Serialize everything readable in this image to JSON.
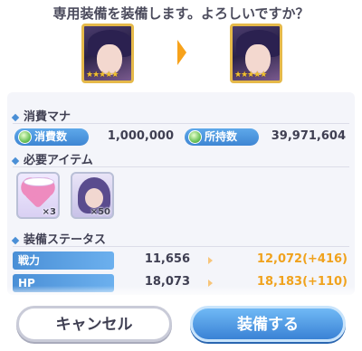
{
  "dialog": {
    "title": "専用装備を装備します。よろしいですか？",
    "portrait_before_stars": "★★★★★",
    "portrait_after_stars": "★★★★★"
  },
  "mana": {
    "heading": "消費マナ",
    "cost_label": "消費数",
    "cost_value": "1,000,000",
    "owned_label": "所持数",
    "owned_value": "39,971,604"
  },
  "items": {
    "heading": "必要アイテム",
    "list": [
      {
        "icon": "heart-item-icon",
        "qty": "×3"
      },
      {
        "icon": "memory-piece-icon",
        "qty": "×50"
      }
    ]
  },
  "stats": {
    "heading": "装備ステータス",
    "rows": [
      {
        "label": "戦力",
        "before": "11,656",
        "after": "12,072(+416)"
      },
      {
        "label": "HP",
        "before": "18,073",
        "after": "18,183(+110)"
      }
    ]
  },
  "buttons": {
    "cancel": "キャンセル",
    "confirm": "装備する"
  },
  "colors": {
    "accent_blue": "#4a8fd6",
    "arrow_orange": "#f7a21b",
    "increase_orange": "#f0a21d"
  }
}
